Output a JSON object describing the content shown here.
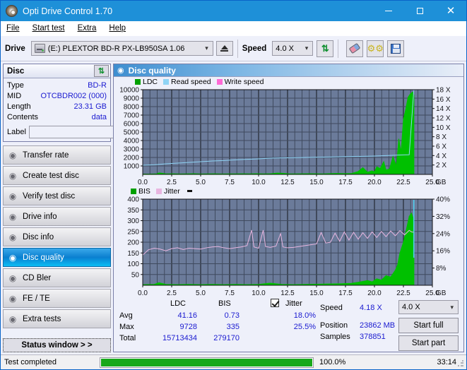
{
  "window": {
    "title": "Opti Drive Control 1.70",
    "icon": "disc-icon",
    "minimize": "—",
    "maximize": "□",
    "close": "✕"
  },
  "menu": {
    "items": [
      "File",
      "Start test",
      "Extra",
      "Help"
    ]
  },
  "toolbar": {
    "drive_label": "Drive",
    "drive_value": "(E:)   PLEXTOR BD-R  PX-LB950SA 1.06",
    "eject_title": "Eject",
    "speed_label": "Speed",
    "speed_value": "4.0 X",
    "refresh_icon": "refresh-icon",
    "eraser_icon": "eraser-icon",
    "gears_icon": "gears-icon",
    "save_icon": "save-icon"
  },
  "disc": {
    "header": "Disc",
    "refresh_icon": "refresh-icon",
    "rows": [
      {
        "key": "Type",
        "value": "BD-R"
      },
      {
        "key": "MID",
        "value": "OTCBDR002 (000)"
      },
      {
        "key": "Length",
        "value": "23.31 GB"
      },
      {
        "key": "Contents",
        "value": "data"
      }
    ],
    "label_key": "Label",
    "label_value": "",
    "label_placeholder": "",
    "label_button_icon": "disc-icon"
  },
  "sidebar": {
    "items": [
      {
        "label": "Transfer rate",
        "icon": "disc-test-icon",
        "active": false
      },
      {
        "label": "Create test disc",
        "icon": "disc-burn-icon",
        "active": false
      },
      {
        "label": "Verify test disc",
        "icon": "disc-verify-icon",
        "active": false
      },
      {
        "label": "Drive info",
        "icon": "drive-info-icon",
        "active": false
      },
      {
        "label": "Disc info",
        "icon": "disc-info-icon",
        "active": false
      },
      {
        "label": "Disc quality",
        "icon": "disc-quality-icon",
        "active": true
      },
      {
        "label": "CD Bler",
        "icon": "disc-bler-icon",
        "active": false
      },
      {
        "label": "FE / TE",
        "icon": "disc-fete-icon",
        "active": false
      },
      {
        "label": "Extra tests",
        "icon": "disc-extra-icon",
        "active": false
      }
    ],
    "status_window_button": "Status window > >"
  },
  "panel": {
    "title": "Disc quality",
    "icon": "disc-quality-icon"
  },
  "stats": {
    "col_headers": [
      "LDC",
      "BIS"
    ],
    "jitter_label": "Jitter",
    "jitter_checked": true,
    "rows": [
      {
        "name": "Avg",
        "ldc": "41.16",
        "bis": "0.73",
        "jitter": "18.0%"
      },
      {
        "name": "Max",
        "ldc": "9728",
        "bis": "335",
        "jitter": "25.5%"
      },
      {
        "name": "Total",
        "ldc": "15713434",
        "bis": "279170",
        "jitter": ""
      }
    ],
    "speed_label": "Speed",
    "speed_value": "4.18 X",
    "position_label": "Position",
    "position_value": "23862 MB",
    "samples_label": "Samples",
    "samples_value": "378851",
    "speed_select": "4.0 X",
    "start_full_button": "Start full",
    "start_part_button": "Start part"
  },
  "statusbar": {
    "message": "Test completed",
    "progress_percent": "100.0%",
    "progress_value": 100,
    "elapsed": "33:14"
  },
  "chart_data": [
    {
      "type": "area",
      "id": "ldc-chart",
      "title": "",
      "xlabel": "GB",
      "ylabel": "",
      "xlim": [
        0,
        25.0
      ],
      "xticks": [
        "0.0",
        "2.5",
        "5.0",
        "7.5",
        "10.0",
        "12.5",
        "15.0",
        "17.5",
        "20.0",
        "22.5",
        "25.0"
      ],
      "ylim": [
        0,
        10000
      ],
      "yticks": [
        "10000",
        "9000",
        "8000",
        "7000",
        "6000",
        "5000",
        "4000",
        "3000",
        "2000",
        "1000"
      ],
      "y2lim": [
        0,
        18
      ],
      "y2ticks": [
        "18 X",
        "16 X",
        "14 X",
        "12 X",
        "10 X",
        "8 X",
        "6 X",
        "4 X",
        "2 X"
      ],
      "y2unit": "X",
      "xunit": "GB",
      "grid": true,
      "legend": [
        {
          "name": "LDC",
          "color": "#00a000"
        },
        {
          "name": "Read speed",
          "color": "#8fd4f5"
        },
        {
          "name": "Write speed",
          "color": "#ff6ad5"
        }
      ],
      "series": [
        {
          "name": "LDC",
          "color": "#00c000",
          "kind": "area",
          "x": [
            0.0,
            0.6,
            1.2,
            1.4,
            1.6,
            2.0,
            2.6,
            3.2,
            3.8,
            4.4,
            5.0,
            5.6,
            6.2,
            6.8,
            7.4,
            8.0,
            8.6,
            9.2,
            9.8,
            10.4,
            11.0,
            11.6,
            12.0,
            12.6,
            13.2,
            13.8,
            14.4,
            15.0,
            15.6,
            16.2,
            16.8,
            17.4,
            18.0,
            18.6,
            19.0,
            19.4,
            19.8,
            20.0,
            20.2,
            20.5,
            20.8,
            21.0,
            21.3,
            21.6,
            21.9,
            22.1,
            22.3,
            22.5,
            22.7,
            22.9,
            23.1,
            23.3,
            23.4
          ],
          "y": [
            40,
            45,
            60,
            180,
            150,
            60,
            70,
            55,
            60,
            80,
            55,
            60,
            70,
            55,
            65,
            60,
            70,
            60,
            80,
            60,
            70,
            160,
            140,
            70,
            60,
            70,
            80,
            70,
            60,
            90,
            110,
            90,
            100,
            350,
            800,
            250,
            420,
            300,
            900,
            700,
            1500,
            500,
            650,
            2100,
            1000,
            4200,
            2600,
            6500,
            7700,
            9100,
            9500,
            9728,
            9400
          ]
        },
        {
          "name": "Read speed",
          "color": "#8fd4f5",
          "kind": "line",
          "axis": "y2",
          "x": [
            0.0,
            1.0,
            2.0,
            3.0,
            4.0,
            5.0,
            6.0,
            7.0,
            8.0,
            9.0,
            10.0,
            11.0,
            12.0,
            13.0,
            14.0,
            15.0,
            16.0,
            17.0,
            18.0,
            19.0,
            20.0,
            21.0,
            22.0,
            23.0,
            23.4
          ],
          "y": [
            1.95,
            2.05,
            2.25,
            2.4,
            2.55,
            2.7,
            2.85,
            2.95,
            3.1,
            3.2,
            3.3,
            3.45,
            3.5,
            3.55,
            3.6,
            3.65,
            3.7,
            3.75,
            3.8,
            3.85,
            3.9,
            4.0,
            4.1,
            4.18,
            18.0
          ]
        }
      ]
    },
    {
      "type": "line",
      "id": "bis-jitter-chart",
      "title": "",
      "xlabel": "GB",
      "xlim": [
        0,
        25.0
      ],
      "xticks": [
        "0.0",
        "2.5",
        "5.0",
        "7.5",
        "10.0",
        "12.5",
        "15.0",
        "17.5",
        "20.0",
        "22.5",
        "25.0"
      ],
      "ylim": [
        0,
        400
      ],
      "yticks": [
        "400",
        "350",
        "300",
        "250",
        "200",
        "150",
        "100",
        "50"
      ],
      "y2lim": [
        0,
        40
      ],
      "y2ticks": [
        "40%",
        "32%",
        "24%",
        "16%",
        "8%"
      ],
      "grid": true,
      "legend": [
        {
          "name": "BIS",
          "color": "#00a000"
        },
        {
          "name": "Jitter",
          "color": "#e8b6e0"
        }
      ],
      "series": [
        {
          "name": "BIS",
          "color": "#00c000",
          "kind": "area",
          "x": [
            0.0,
            1.0,
            1.4,
            2.0,
            3.0,
            4.0,
            5.0,
            6.0,
            7.0,
            8.0,
            9.0,
            10.0,
            11.0,
            12.0,
            13.0,
            14.0,
            15.0,
            16.0,
            17.0,
            18.0,
            18.6,
            19.0,
            19.4,
            19.8,
            20.2,
            20.6,
            21.0,
            21.4,
            21.8,
            22.0,
            22.2,
            22.5,
            22.8,
            23.0,
            23.2,
            23.4
          ],
          "y": [
            3,
            4,
            12,
            4,
            3,
            4,
            3,
            4,
            3,
            4,
            3,
            4,
            10,
            4,
            3,
            4,
            5,
            6,
            7,
            9,
            14,
            18,
            22,
            16,
            30,
            24,
            45,
            38,
            70,
            95,
            150,
            200,
            270,
            320,
            335,
            300
          ]
        },
        {
          "name": "Jitter",
          "color": "#e8b6e0",
          "kind": "line",
          "axis": "y2",
          "x": [
            0.0,
            0.5,
            1.0,
            1.5,
            2.0,
            2.5,
            3.0,
            3.5,
            4.0,
            4.5,
            5.0,
            5.5,
            6.0,
            6.5,
            7.0,
            7.5,
            8.0,
            8.5,
            9.0,
            9.4,
            9.6,
            10.0,
            10.4,
            10.6,
            11.0,
            11.5,
            11.9,
            12.1,
            12.5,
            13.0,
            13.5,
            14.0,
            14.5,
            15.0,
            15.4,
            15.8,
            16.2,
            16.6,
            17.0,
            17.4,
            17.8,
            18.2,
            18.6,
            19.0,
            19.4,
            19.8,
            20.2,
            20.6,
            21.0,
            21.4,
            21.8,
            22.2,
            22.6,
            23.0,
            23.2,
            23.4
          ],
          "y": [
            14.0,
            16.5,
            17.2,
            16.8,
            16.0,
            17.0,
            17.4,
            16.6,
            17.2,
            17.0,
            16.8,
            17.4,
            17.8,
            18.0,
            17.4,
            17.0,
            17.4,
            17.8,
            18.4,
            25.6,
            17.8,
            17.2,
            25.6,
            18.0,
            17.6,
            18.2,
            24.0,
            17.8,
            17.4,
            17.6,
            18.0,
            18.4,
            18.8,
            19.2,
            24.5,
            19.6,
            20.0,
            24.2,
            20.4,
            24.8,
            21.0,
            24.6,
            21.4,
            24.4,
            21.8,
            24.8,
            22.2,
            25.0,
            22.6,
            25.2,
            23.0,
            25.4,
            23.4,
            25.5,
            24.8,
            24.6
          ]
        }
      ]
    }
  ]
}
